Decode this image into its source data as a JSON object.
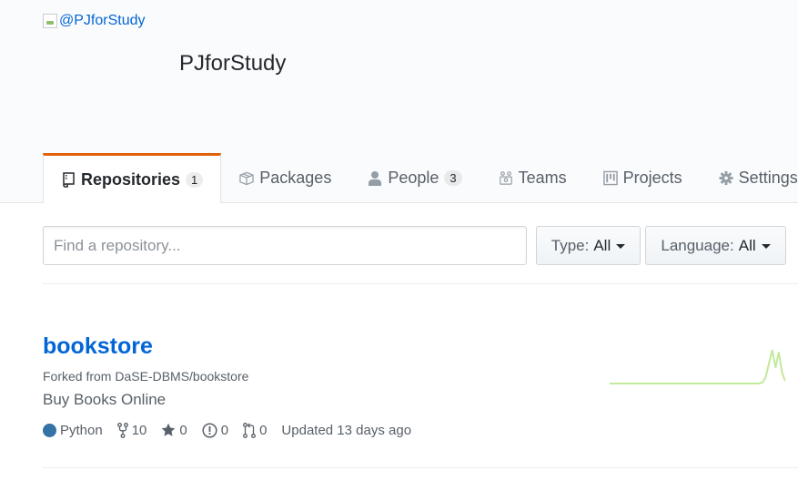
{
  "org": {
    "avatar_alt": "@PJforStudy",
    "name": "PJforStudy"
  },
  "tabs": [
    {
      "label": "Repositories",
      "count": "1",
      "icon": "repo-icon"
    },
    {
      "label": "Packages",
      "icon": "package-icon"
    },
    {
      "label": "People",
      "count": "3",
      "icon": "person-icon"
    },
    {
      "label": "Teams",
      "icon": "teams-icon"
    },
    {
      "label": "Projects",
      "icon": "project-icon"
    },
    {
      "label": "Settings",
      "icon": "gear-icon"
    }
  ],
  "filters": {
    "search_placeholder": "Find a repository...",
    "type_label": "Type:",
    "type_value": "All",
    "language_label": "Language:",
    "language_value": "All"
  },
  "repos": [
    {
      "name": "bookstore",
      "forked_prefix": "Forked from ",
      "forked_from": "DaSE-DBMS/bookstore",
      "description": "Buy Books Online",
      "language": "Python",
      "language_color": "#3572A5",
      "forks": "10",
      "stars": "0",
      "issues": "0",
      "pull_requests": "0",
      "updated": "Updated 13 days ago",
      "activity": [
        0,
        0,
        0,
        0,
        0,
        0,
        0,
        0,
        0,
        0,
        0,
        0,
        0,
        0,
        0,
        0,
        0,
        0,
        0,
        0,
        0,
        0,
        0,
        0,
        0,
        0,
        0,
        0,
        0,
        0,
        0,
        0,
        0,
        0,
        0,
        0,
        0,
        0,
        0,
        0,
        0,
        0,
        0,
        0,
        0,
        0,
        0,
        1,
        6,
        18,
        30,
        14,
        28,
        10,
        2
      ]
    }
  ],
  "colors": {
    "accent": "#e36209",
    "link": "#0366d6",
    "sparkline": "#c2e99c"
  }
}
